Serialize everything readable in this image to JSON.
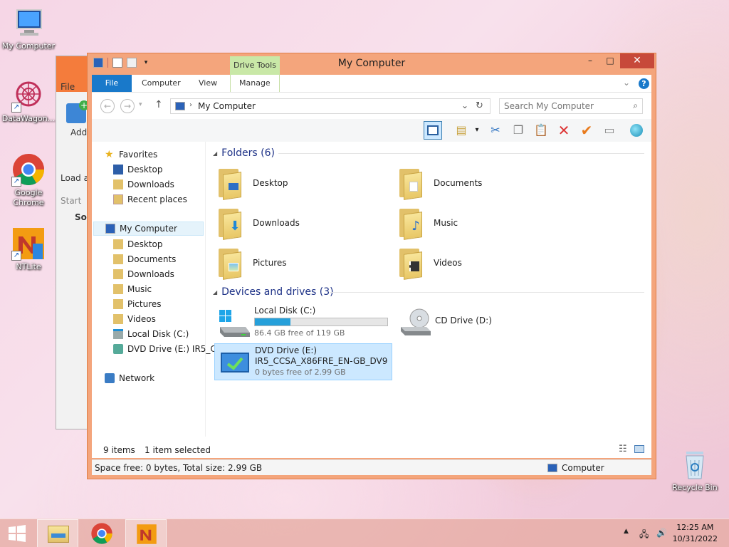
{
  "desktop": {
    "icons": [
      {
        "label": "My Computer"
      },
      {
        "label": "DataWagon..."
      },
      {
        "label": "Google Chrome"
      },
      {
        "label": "NTLite"
      },
      {
        "label": "Recycle Bin"
      }
    ]
  },
  "bg_window": {
    "texts": [
      "File",
      "Add",
      "Load ar",
      "Start",
      "Sou"
    ]
  },
  "window": {
    "title": "My Computer",
    "context_tab": "Drive Tools",
    "tabs": [
      "File",
      "Computer",
      "View",
      "Manage"
    ],
    "controls": {
      "minimize": "–",
      "maximize": "□",
      "close": "✕"
    }
  },
  "address": {
    "path": "My Computer",
    "search_placeholder": "Search My Computer"
  },
  "nav": {
    "favorites_label": "Favorites",
    "favorites": [
      "Desktop",
      "Downloads",
      "Recent places"
    ],
    "computer_label": "My Computer",
    "computer_items": [
      "Desktop",
      "Documents",
      "Downloads",
      "Music",
      "Pictures",
      "Videos",
      "Local Disk (C:)",
      "DVD Drive (E:) IR5_C"
    ],
    "network_label": "Network"
  },
  "folders": {
    "header": "Folders (6)",
    "items": [
      "Desktop",
      "Documents",
      "Downloads",
      "Music",
      "Pictures",
      "Videos"
    ]
  },
  "drives": {
    "header": "Devices and drives (3)",
    "local": {
      "name": "Local Disk (C:)",
      "free": "86.4 GB free of 119 GB",
      "used_fraction": 0.27
    },
    "cd": {
      "name": "CD Drive (D:)"
    },
    "dvd": {
      "name": "DVD Drive (E:)",
      "label": "IR5_CCSA_X86FRE_EN-GB_DV9",
      "free": "0 bytes free of 2.99 GB"
    }
  },
  "status": {
    "items": "9 items",
    "selected": "1 item selected",
    "details": "Space free: 0 bytes, Total size: 2.99 GB",
    "location": "Computer"
  },
  "taskbar": {
    "time": "12:25 AM",
    "date": "10/31/2022"
  },
  "colors": {
    "accent": "#1979ca",
    "window_frame": "#f4a57c",
    "selection": "#cce8ff",
    "capacity_fill": "#26a0da"
  }
}
